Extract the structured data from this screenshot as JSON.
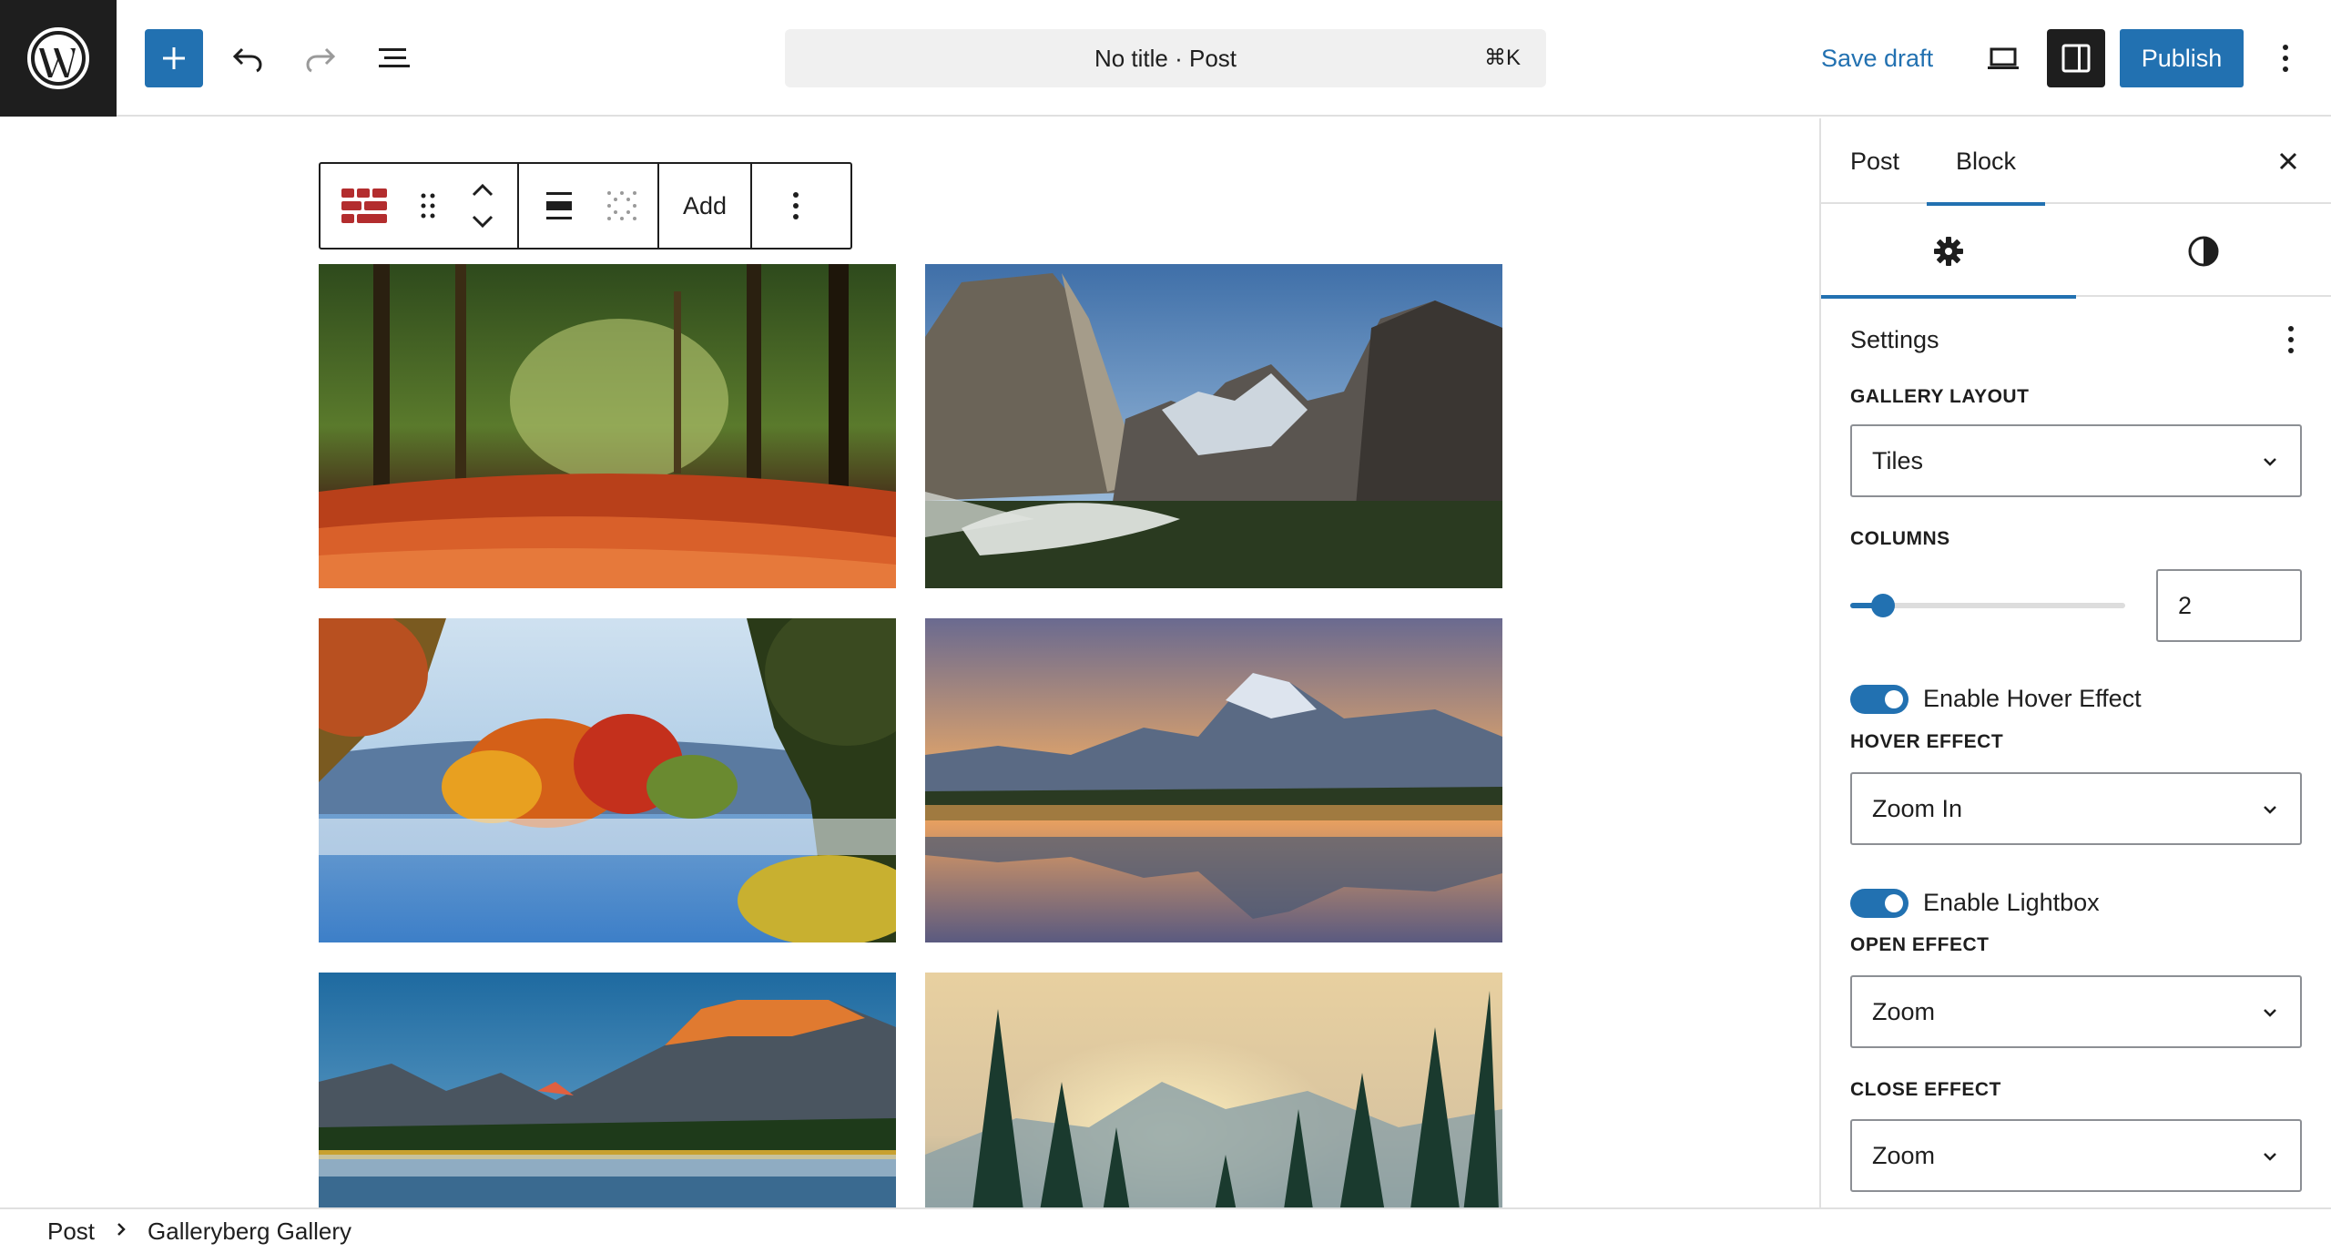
{
  "header": {
    "doc_title": "No title · Post",
    "shortcut": "⌘K",
    "save_draft": "Save draft",
    "publish": "Publish"
  },
  "block_toolbar": {
    "add_label": "Add"
  },
  "gallery": {
    "images": [
      {
        "icon": "autumn-forest-path-image"
      },
      {
        "icon": "yosemite-valley-image"
      },
      {
        "icon": "autumn-lake-image"
      },
      {
        "icon": "mountain-reflection-sunset-image"
      },
      {
        "icon": "alpine-lake-mountains-image"
      },
      {
        "icon": "pine-forest-sunrise-image"
      }
    ]
  },
  "breadcrumb": {
    "root": "Post",
    "current": "Galleryberg Gallery"
  },
  "sidebar": {
    "tabs": [
      "Post",
      "Block"
    ],
    "active_tab": "Block",
    "panel_title": "Settings",
    "gallery_layout": {
      "label": "Gallery Layout",
      "value": "Tiles"
    },
    "columns": {
      "label": "Columns",
      "value": "2",
      "slider_fraction": 0.12
    },
    "hover_toggle": {
      "label": "Enable Hover Effect",
      "on": true
    },
    "hover_effect": {
      "label": "Hover Effect",
      "value": "Zoom In"
    },
    "lightbox_toggle": {
      "label": "Enable Lightbox",
      "on": true
    },
    "open_effect": {
      "label": "Open Effect",
      "value": "Zoom"
    },
    "close_effect": {
      "label": "Close Effect",
      "value": "Zoom"
    }
  },
  "colors": {
    "accent": "#2271b1",
    "dark": "#1e1e1e",
    "border": "#e0e0e0"
  }
}
